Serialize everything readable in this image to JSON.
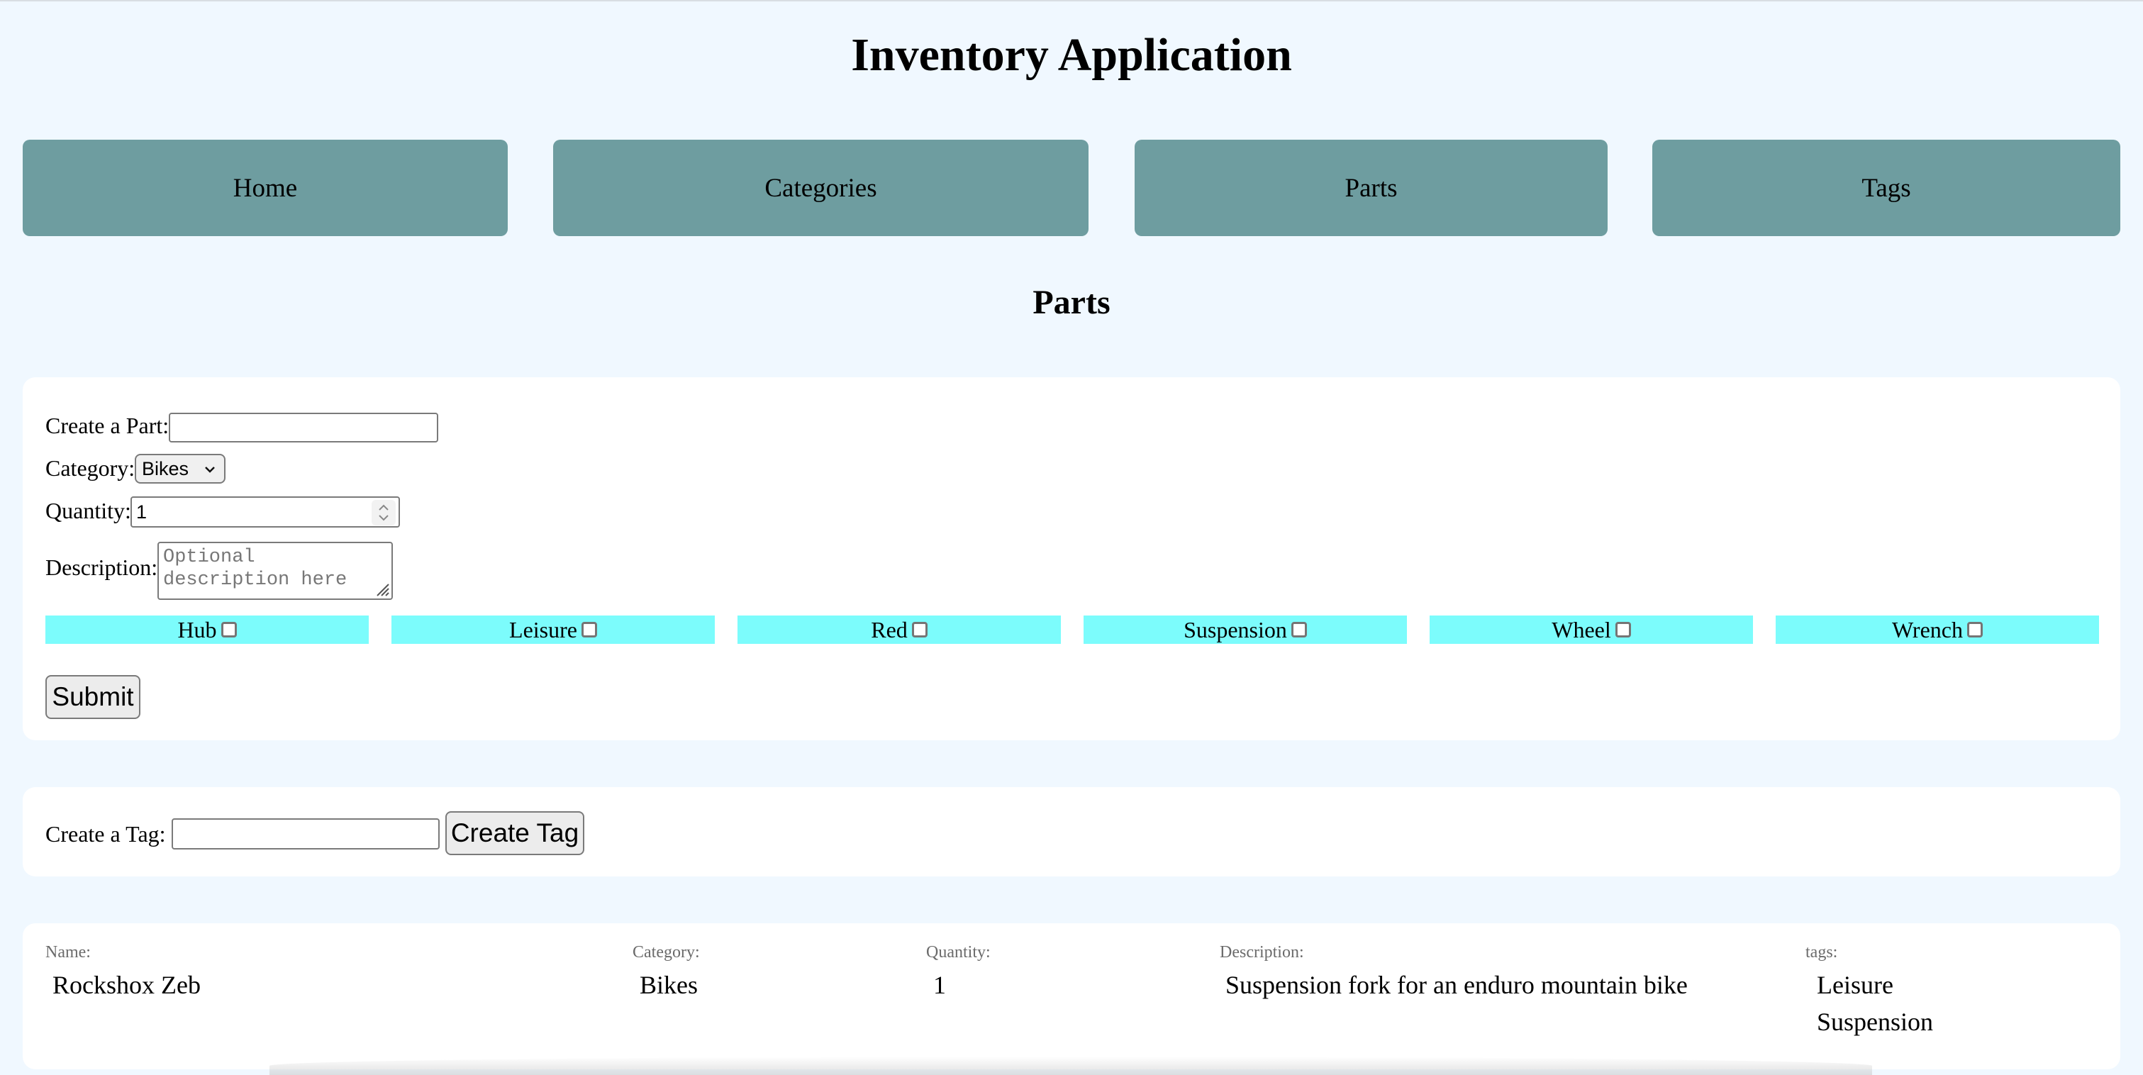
{
  "app": {
    "title": "Inventory Application"
  },
  "nav": {
    "items": [
      {
        "label": "Home"
      },
      {
        "label": "Categories"
      },
      {
        "label": "Parts"
      },
      {
        "label": "Tags"
      }
    ]
  },
  "page": {
    "section_title": "Parts"
  },
  "part_form": {
    "name_label": "Create a Part:",
    "name_value": "",
    "category_label": "Category:",
    "category_selected": "Bikes",
    "quantity_label": "Quantity:",
    "quantity_value": "1",
    "description_label": "Description:",
    "description_placeholder": "Optional description here",
    "tags": [
      {
        "label": "Hub",
        "checked": false
      },
      {
        "label": "Leisure",
        "checked": false
      },
      {
        "label": "Red",
        "checked": false
      },
      {
        "label": "Suspension",
        "checked": false
      },
      {
        "label": "Wheel",
        "checked": false
      },
      {
        "label": "Wrench",
        "checked": false
      }
    ],
    "submit_label": "Submit"
  },
  "tag_form": {
    "label": "Create a Tag:",
    "value": "",
    "button_label": "Create Tag"
  },
  "parts_list": {
    "headers": {
      "name": "Name:",
      "category": "Category:",
      "quantity": "Quantity:",
      "description": "Description:",
      "tags": "tags:"
    },
    "rows": [
      {
        "name": "Rockshox Zeb",
        "category": "Bikes",
        "quantity": "1",
        "description": "Suspension fork for an enduro mountain bike",
        "tags": [
          "Leisure",
          "Suspension"
        ]
      }
    ]
  }
}
